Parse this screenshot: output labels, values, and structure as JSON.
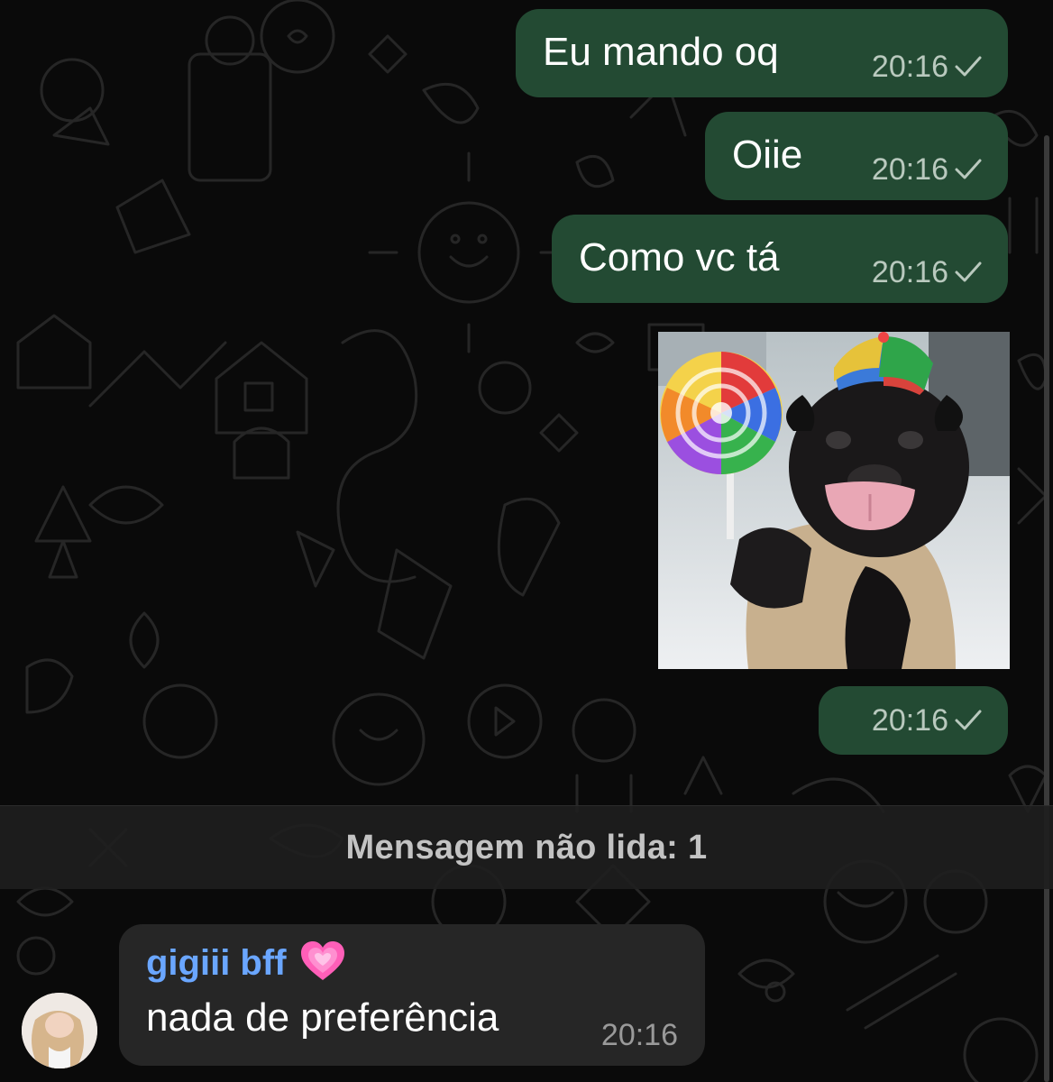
{
  "chat": {
    "outgoing": [
      {
        "text": "Eu mando oq",
        "time": "20:16",
        "status": "sent-check-icon"
      },
      {
        "text": "Oiie",
        "time": "20:16",
        "status": "sent-check-icon"
      },
      {
        "text": "Como vc tá",
        "time": "20:16",
        "status": "sent-check-icon"
      }
    ],
    "sticker": {
      "time": "20:16",
      "status": "sent-check-icon"
    },
    "unread_divider": "Mensagem não lida: 1",
    "incoming": {
      "sender": "gigiii bff",
      "sender_emoji": "pink-heart-icon",
      "text": "nada de preferência",
      "time": "20:16"
    }
  },
  "colors": {
    "background": "#0a0a0a",
    "outgoing_bubble": "#234a33",
    "incoming_bubble": "#262626",
    "sender_name": "#6aa6ff",
    "heart": "#ff5fb8"
  }
}
